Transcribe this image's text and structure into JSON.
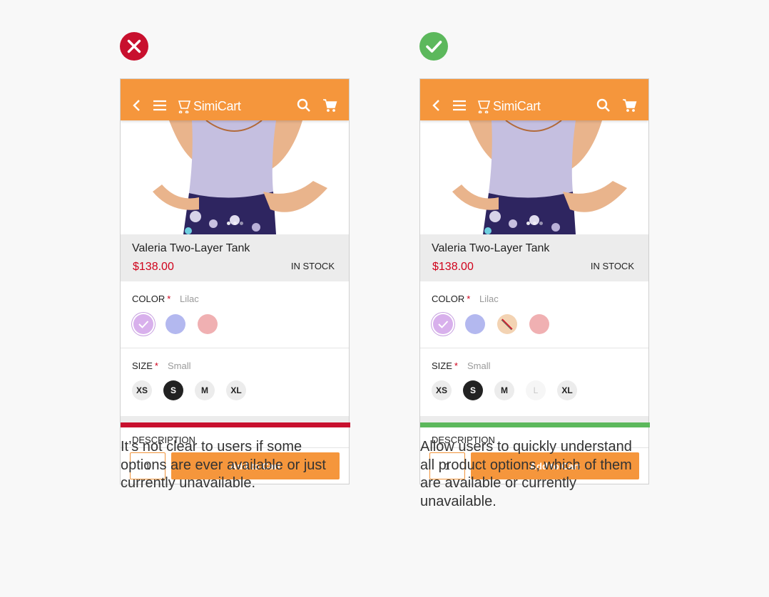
{
  "colors": {
    "background": "#f8f8f8",
    "brand_orange": "#f5963c",
    "bad_red": "#c8102e",
    "good_green": "#5cb85c",
    "price_red": "#d0021b"
  },
  "panels": [
    {
      "verdict_icon": "cross-icon",
      "appbar": {
        "logo_text": "SimiCart"
      },
      "product": {
        "name": "Valeria Two-Layer Tank",
        "price": "$138.00",
        "stock": "IN STOCK"
      },
      "color_option": {
        "title": "COLOR",
        "required_mark": "*",
        "selected": "Lilac",
        "swatches": [
          {
            "name": "lilac",
            "hex": "#d8b0ec",
            "selected": true,
            "available": true
          },
          {
            "name": "periwinkle",
            "hex": "#b3b8ef",
            "selected": false,
            "available": true
          },
          {
            "name": "pink",
            "hex": "#f0b0b2",
            "selected": false,
            "available": true
          }
        ]
      },
      "size_option": {
        "title": "SIZE",
        "required_mark": "*",
        "selected": "Small",
        "sizes": [
          {
            "label": "XS",
            "selected": false,
            "available": true
          },
          {
            "label": "S",
            "selected": true,
            "available": true
          },
          {
            "label": "M",
            "selected": false,
            "available": true
          },
          {
            "label": "XL",
            "selected": false,
            "available": true
          }
        ]
      },
      "description_title": "DESCRIPTION",
      "quantity": "1",
      "add_to_cart_label": "Add to Cart",
      "caption": "It’s not clear to users if some options are ever available or just currently unavailable."
    },
    {
      "verdict_icon": "check-icon",
      "appbar": {
        "logo_text": "SimiCart"
      },
      "product": {
        "name": "Valeria Two-Layer Tank",
        "price": "$138.00",
        "stock": "IN STOCK"
      },
      "color_option": {
        "title": "COLOR",
        "required_mark": "*",
        "selected": "Lilac",
        "swatches": [
          {
            "name": "lilac",
            "hex": "#d8b0ec",
            "selected": true,
            "available": true
          },
          {
            "name": "periwinkle",
            "hex": "#b3b8ef",
            "selected": false,
            "available": true
          },
          {
            "name": "peach",
            "hex": "#f3d3b3",
            "selected": false,
            "available": false
          },
          {
            "name": "pink",
            "hex": "#f0b0b2",
            "selected": false,
            "available": true
          }
        ]
      },
      "size_option": {
        "title": "SIZE",
        "required_mark": "*",
        "selected": "Small",
        "sizes": [
          {
            "label": "XS",
            "selected": false,
            "available": true
          },
          {
            "label": "S",
            "selected": true,
            "available": true
          },
          {
            "label": "M",
            "selected": false,
            "available": true
          },
          {
            "label": "L",
            "selected": false,
            "available": false
          },
          {
            "label": "XL",
            "selected": false,
            "available": true
          }
        ]
      },
      "description_title": "DESCRIPTION",
      "quantity": "1",
      "add_to_cart_label": "Add to Cart",
      "caption": "Allow users to quickly understand all product options, which of them are available or currently unavailable."
    }
  ]
}
